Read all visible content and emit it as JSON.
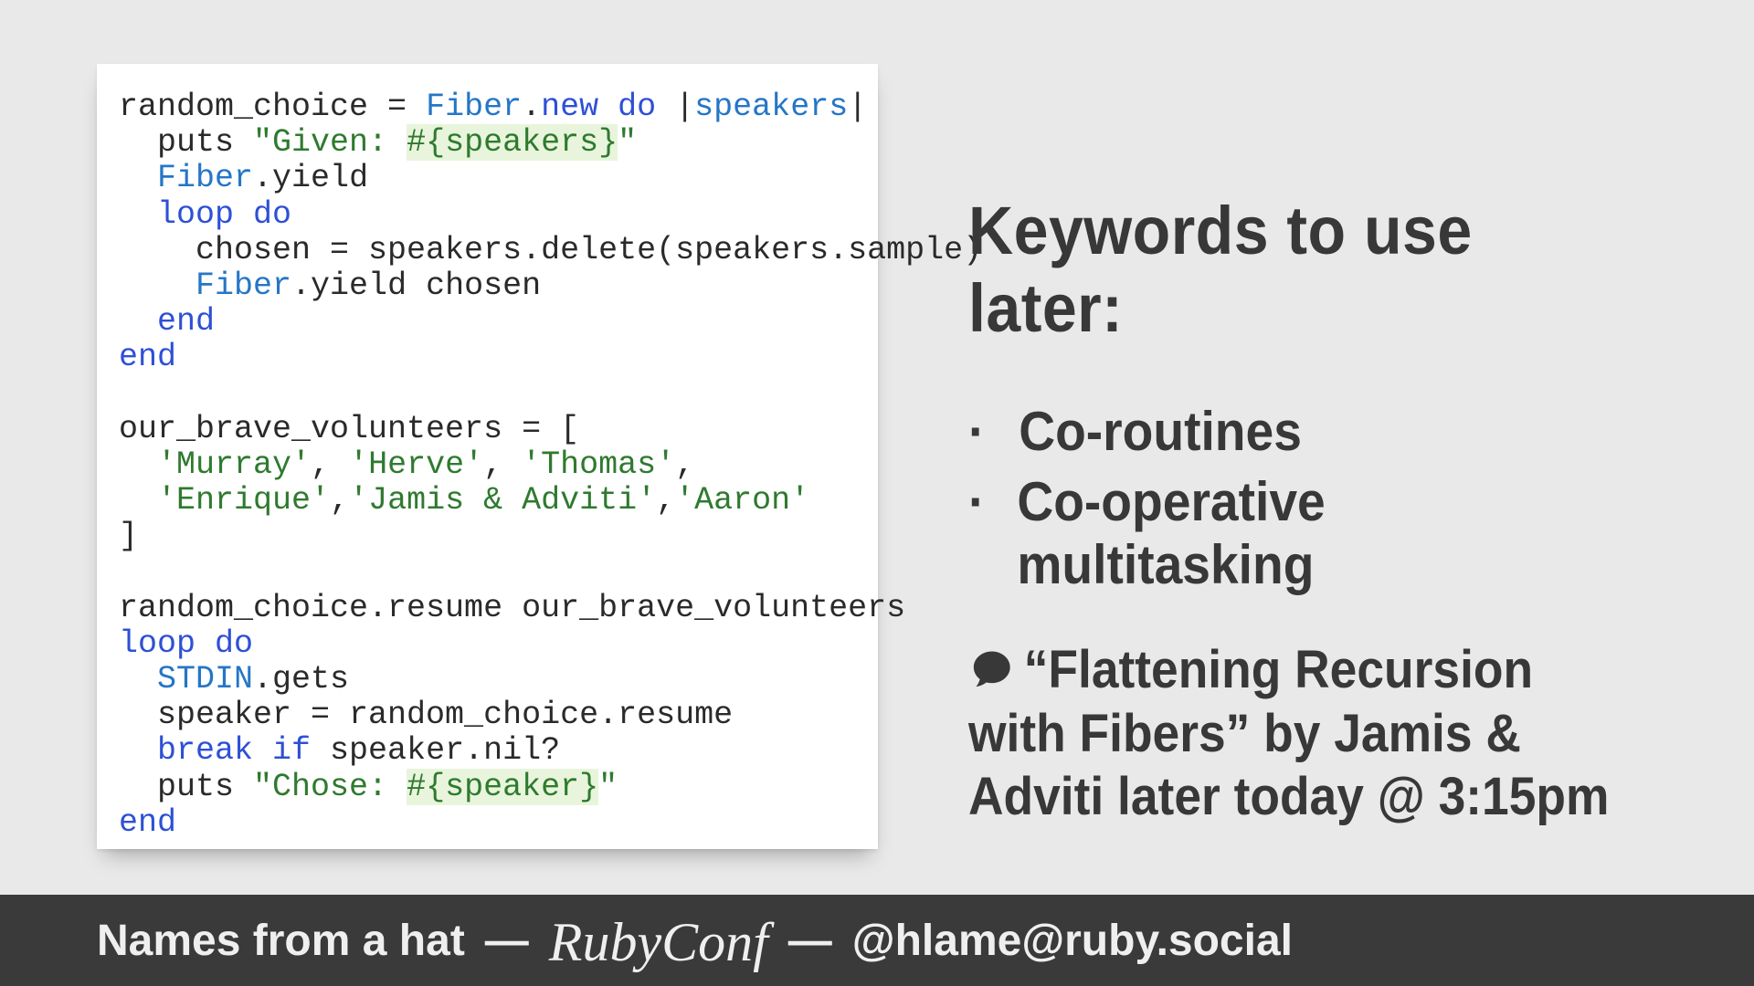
{
  "code": {
    "tokens": [
      [
        [
          "random_choice = ",
          ""
        ],
        [
          "Fiber",
          "c-const"
        ],
        [
          ".",
          ""
        ],
        [
          "new",
          "c-kw"
        ],
        [
          " ",
          ""
        ],
        [
          "do",
          "c-kw"
        ],
        [
          " |",
          ""
        ],
        [
          "speakers",
          "c-param"
        ],
        [
          "|",
          ""
        ]
      ],
      [
        [
          "  puts ",
          ""
        ],
        [
          "\"Given: ",
          "c-str"
        ],
        [
          "#{speakers}",
          "c-str c-interp"
        ],
        [
          "\"",
          "c-str"
        ]
      ],
      [
        [
          "  ",
          ""
        ],
        [
          "Fiber",
          "c-const"
        ],
        [
          ".yield",
          ""
        ]
      ],
      [
        [
          "  ",
          ""
        ],
        [
          "loop do",
          "c-kw"
        ]
      ],
      [
        [
          "    chosen = speakers.delete(speakers.sample)",
          ""
        ]
      ],
      [
        [
          "    ",
          ""
        ],
        [
          "Fiber",
          "c-const"
        ],
        [
          ".yield chosen",
          ""
        ]
      ],
      [
        [
          "  ",
          ""
        ],
        [
          "end",
          "c-kw"
        ]
      ],
      [
        [
          "end",
          "c-kw"
        ]
      ],
      [
        [
          "",
          ""
        ]
      ],
      [
        [
          "our_brave_volunteers = [",
          ""
        ]
      ],
      [
        [
          "  ",
          ""
        ],
        [
          "'Murray'",
          "c-str"
        ],
        [
          ", ",
          ""
        ],
        [
          "'Herve'",
          "c-str"
        ],
        [
          ", ",
          ""
        ],
        [
          "'Thomas'",
          "c-str"
        ],
        [
          ",",
          ""
        ]
      ],
      [
        [
          "  ",
          ""
        ],
        [
          "'Enrique'",
          "c-str"
        ],
        [
          ",",
          ""
        ],
        [
          "'Jamis & Adviti'",
          "c-str"
        ],
        [
          ",",
          ""
        ],
        [
          "'Aaron'",
          "c-str"
        ]
      ],
      [
        [
          "]",
          ""
        ]
      ],
      [
        [
          "",
          ""
        ]
      ],
      [
        [
          "random_choice.resume our_brave_volunteers",
          ""
        ]
      ],
      [
        [
          "loop do",
          "c-kw"
        ]
      ],
      [
        [
          "  ",
          ""
        ],
        [
          "STDIN",
          "c-const"
        ],
        [
          ".gets",
          ""
        ]
      ],
      [
        [
          "  speaker = random_choice.resume",
          ""
        ]
      ],
      [
        [
          "  ",
          ""
        ],
        [
          "break if",
          "c-kw"
        ],
        [
          " speaker.nil?",
          ""
        ]
      ],
      [
        [
          "  puts ",
          ""
        ],
        [
          "\"Chose: ",
          "c-str"
        ],
        [
          "#{speaker}",
          "c-str c-interp"
        ],
        [
          "\"",
          "c-str"
        ]
      ],
      [
        [
          "end",
          "c-kw"
        ]
      ]
    ]
  },
  "right": {
    "heading": "Keywords to use later:",
    "bullets": [
      "Co-routines",
      "Co-operative multitasking"
    ],
    "talk_ref": "“Flattening Recursion with Fibers” by Jamis & Adviti later today @ 3:15pm"
  },
  "footer": {
    "talk_title": "Names from a hat",
    "sep": "—",
    "conference": "RubyConf",
    "handle": "@hlame@ruby.social"
  }
}
